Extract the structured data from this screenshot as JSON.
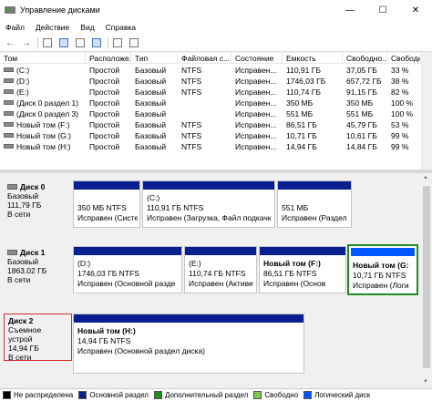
{
  "window": {
    "title": "Управление дисками",
    "minimize": "—",
    "maximize": "☐",
    "close": "✕"
  },
  "menu": [
    "Файл",
    "Действие",
    "Вид",
    "Справка"
  ],
  "toolbar": {
    "back": "←",
    "forward": "→"
  },
  "volumes": {
    "columns": [
      "Том",
      "Расположе...",
      "Тип",
      "Файловая с...",
      "Состояние",
      "Емкость",
      "Свободно...",
      "Свободно %"
    ],
    "rows": [
      [
        "(C:)",
        "Простой",
        "Базовый",
        "NTFS",
        "Исправен...",
        "110,91 ГБ",
        "37,05 ГБ",
        "33 %"
      ],
      [
        "(D:)",
        "Простой",
        "Базовый",
        "NTFS",
        "Исправен...",
        "1746,03 ГБ",
        "657,72 ГБ",
        "38 %"
      ],
      [
        "(E:)",
        "Простой",
        "Базовый",
        "NTFS",
        "Исправен...",
        "110,74 ГБ",
        "91,15 ГБ",
        "82 %"
      ],
      [
        "(Диск 0 раздел 1)",
        "Простой",
        "Базовый",
        "",
        "Исправен...",
        "350 МБ",
        "350 МБ",
        "100 %"
      ],
      [
        "(Диск 0 раздел 3)",
        "Простой",
        "Базовый",
        "",
        "Исправен...",
        "551 МБ",
        "551 МБ",
        "100 %"
      ],
      [
        "Новый том (F:)",
        "Простой",
        "Базовый",
        "NTFS",
        "Исправен...",
        "86,51 ГБ",
        "45,79 ГБ",
        "53 %"
      ],
      [
        "Новый том (G:)",
        "Простой",
        "Базовый",
        "NTFS",
        "Исправен...",
        "10,71 ГБ",
        "10,61 ГБ",
        "99 %"
      ],
      [
        "Новый том (H:)",
        "Простой",
        "Базовый",
        "NTFS",
        "Исправен...",
        "14,94 ГБ",
        "14,84 ГБ",
        "99 %"
      ]
    ]
  },
  "disks": [
    {
      "name": "Диск 0",
      "type": "Базовый",
      "size": "111,79 ГБ",
      "status": "В сети",
      "partitions": [
        {
          "title": "",
          "line1": "350 МБ NTFS",
          "line2": "Исправен (Систе"
        },
        {
          "title": "(C:)",
          "line1": "110,91 ГБ NTFS",
          "line2": "Исправен (Загрузка, Файл подкачк"
        },
        {
          "title": "",
          "line1": "551 МБ",
          "line2": "Исправен (Раздел"
        }
      ]
    },
    {
      "name": "Диск 1",
      "type": "Базовый",
      "size": "1863,02 ГБ",
      "status": "В сети",
      "partitions": [
        {
          "title": "(D:)",
          "line1": "1746,03 ГБ NTFS",
          "line2": "Исправен (Основной разде"
        },
        {
          "title": "(E:)",
          "line1": "110,74 ГБ NTFS",
          "line2": "Исправен (Активе"
        },
        {
          "title": "Новый том  (F:)",
          "line1": "86,51 ГБ NTFS",
          "line2": "Исправен (Основ"
        },
        {
          "title": "Новый том  (G:",
          "line1": "10,71 ГБ NTFS",
          "line2": "Исправен (Логи"
        }
      ]
    },
    {
      "name": "Диск 2",
      "type": "Съемное устрой",
      "size": "14,94 ГБ",
      "status": "В сети",
      "partitions": [
        {
          "title": "Новый том  (H:)",
          "line1": "14,94 ГБ NTFS",
          "line2": "Исправен (Основной раздел диска)"
        }
      ]
    }
  ],
  "legend": [
    {
      "label": "Не распределена",
      "color": "#000000"
    },
    {
      "label": "Основной раздел",
      "color": "#0a1f8f"
    },
    {
      "label": "Дополнительный раздел",
      "color": "#1f8a1f"
    },
    {
      "label": "Свободно",
      "color": "#7ec850"
    },
    {
      "label": "Логический диск",
      "color": "#0056ff"
    }
  ]
}
